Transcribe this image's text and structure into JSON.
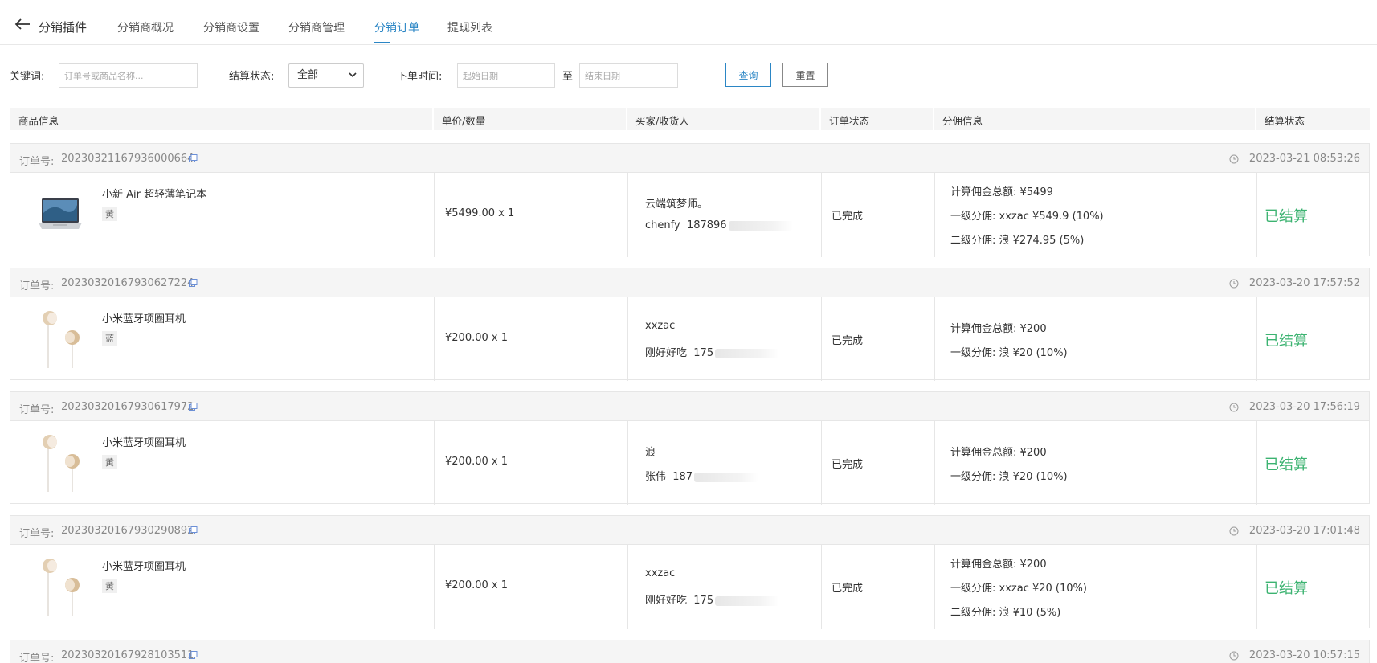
{
  "header": {
    "back_icon": "arrow-left-icon",
    "title": "分销插件",
    "tabs": [
      {
        "label": "分销商概况"
      },
      {
        "label": "分销商设置"
      },
      {
        "label": "分销商管理"
      },
      {
        "label": "分销订单",
        "active": true
      },
      {
        "label": "提现列表"
      }
    ]
  },
  "filters": {
    "keyword_label": "关键词:",
    "keyword_placeholder": "订单号或商品名称...",
    "settle_label": "结算状态:",
    "settle_value": "全部",
    "time_label": "下单时间:",
    "start_placeholder": "起始日期",
    "to_label": "至",
    "end_placeholder": "结束日期",
    "search_btn": "查询",
    "reset_btn": "重置"
  },
  "table": {
    "headers": [
      "商品信息",
      "单价/数量",
      "买家/收货人",
      "订单状态",
      "分佣信息",
      "结算状态"
    ]
  },
  "colors": {
    "accent": "#2b86c5",
    "settled": "#3cb371"
  },
  "orders": [
    {
      "order_label": "订单号:",
      "order_no": "20230321167936000664",
      "time": "2023-03-21 08:53:26",
      "product_name": "小新 Air 超轻薄笔记本",
      "spec": "黄",
      "image": "laptop",
      "price": "¥5499.00 x 1",
      "buyer": "云端筑梦师。",
      "receiver_name": "chenfy",
      "receiver_phone": "187896",
      "status": "已完成",
      "commission": [
        "计算佣金总额: ¥5499",
        "一级分佣: xxzac ¥549.9 (10%)",
        "二级分佣: 浪 ¥274.95 (5%)"
      ],
      "settle": "已结算"
    },
    {
      "order_label": "订单号:",
      "order_no": "20230320167930627224",
      "time": "2023-03-20 17:57:52",
      "product_name": "小米蓝牙项圈耳机",
      "spec": "蓝",
      "image": "earphones",
      "price": "¥200.00 x 1",
      "buyer": "xxzac",
      "receiver_name": "刚好好吃",
      "receiver_phone": "175",
      "status": "已完成",
      "commission": [
        "计算佣金总额: ¥200",
        "一级分佣: 浪 ¥20 (10%)"
      ],
      "settle": "已结算"
    },
    {
      "order_label": "订单号:",
      "order_no": "20230320167930617972",
      "time": "2023-03-20 17:56:19",
      "product_name": "小米蓝牙项圈耳机",
      "spec": "黄",
      "image": "earphones",
      "price": "¥200.00 x 1",
      "buyer": "浪",
      "receiver_name": "张伟",
      "receiver_phone": "187",
      "status": "已完成",
      "commission": [
        "计算佣金总额: ¥200",
        "一级分佣: 浪 ¥20 (10%)"
      ],
      "settle": "已结算"
    },
    {
      "order_label": "订单号:",
      "order_no": "20230320167930290892",
      "time": "2023-03-20 17:01:48",
      "product_name": "小米蓝牙项圈耳机",
      "spec": "黄",
      "image": "earphones",
      "price": "¥200.00 x 1",
      "buyer": "xxzac",
      "receiver_name": "刚好好吃",
      "receiver_phone": "175",
      "status": "已完成",
      "commission": [
        "计算佣金总额: ¥200",
        "一级分佣: xxzac ¥20 (10%)",
        "二级分佣: 浪 ¥10 (5%)"
      ],
      "settle": "已结算"
    },
    {
      "order_label": "订单号:",
      "order_no": "20230320167928103511",
      "time": "2023-03-20 10:57:15"
    }
  ]
}
